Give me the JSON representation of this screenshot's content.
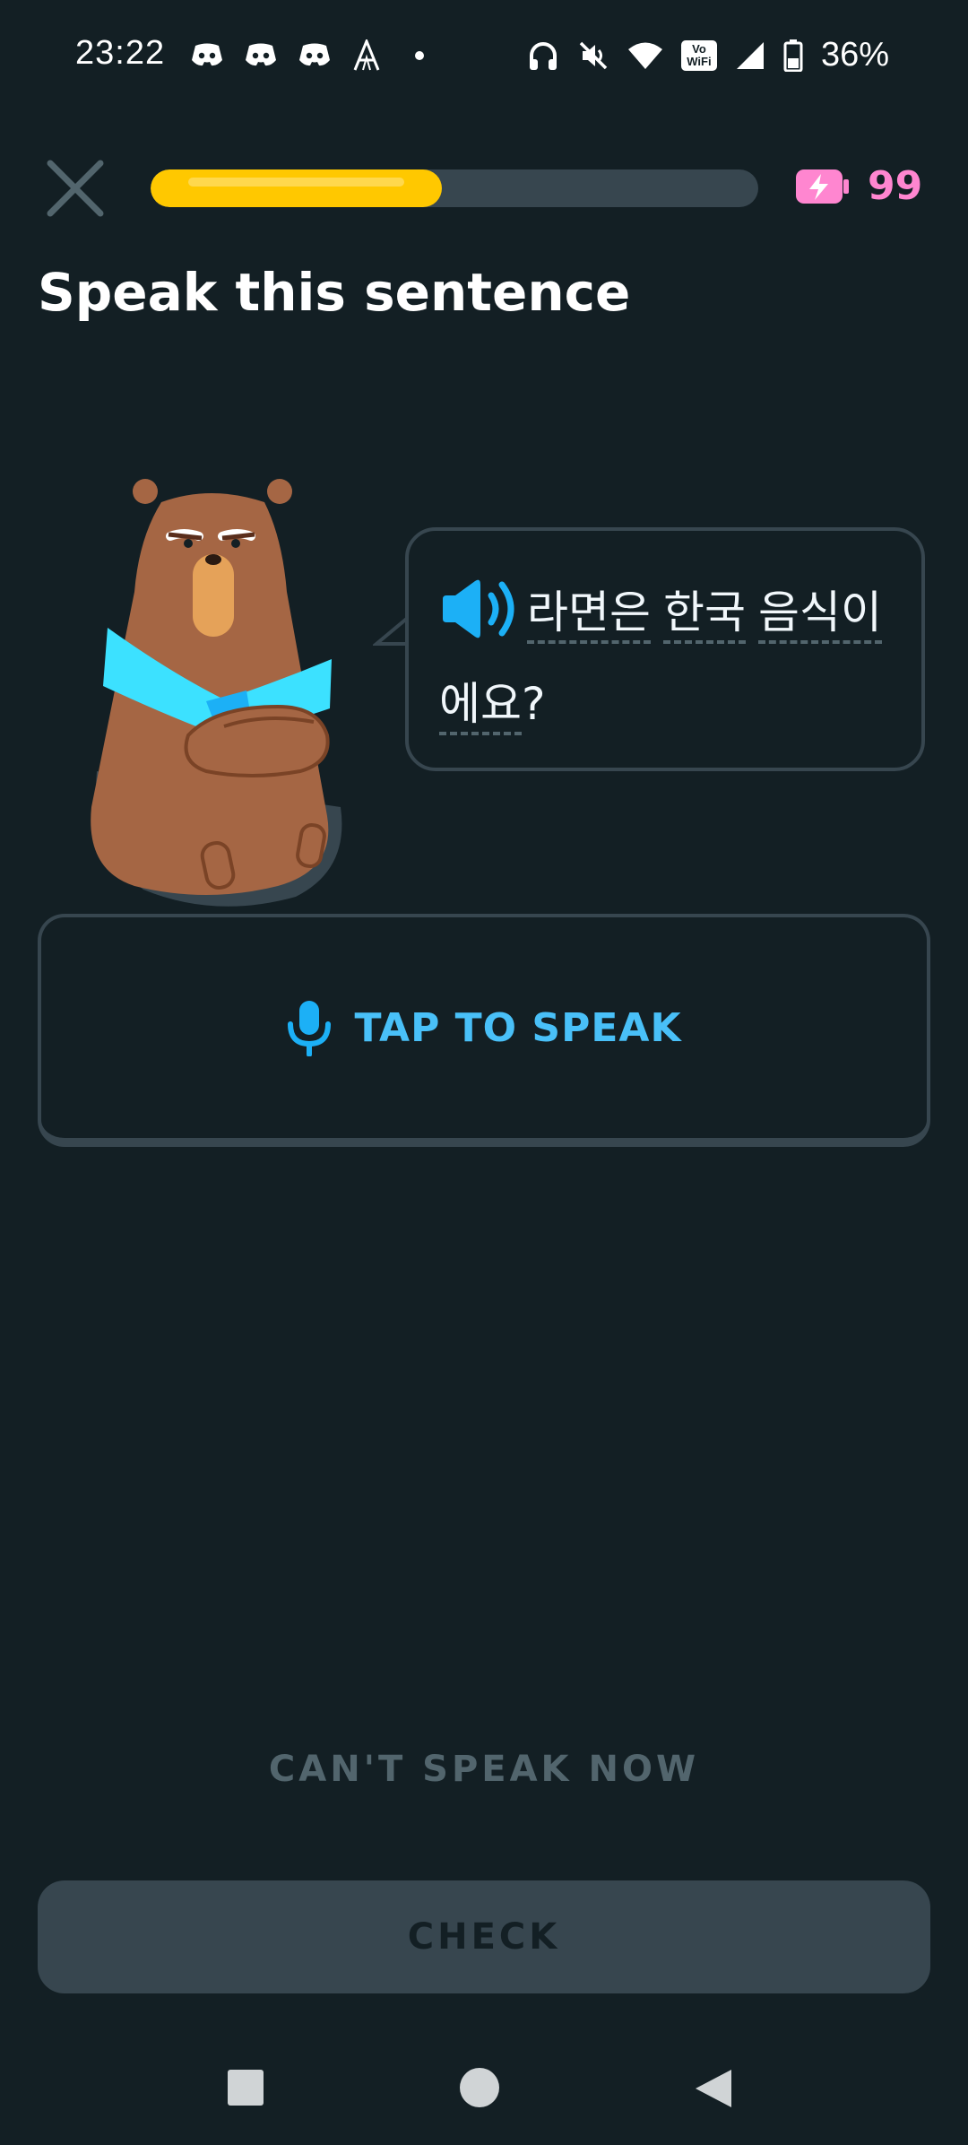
{
  "status_bar": {
    "time": "23:22",
    "battery_percent": "36%",
    "left_icons": [
      "discord-icon",
      "discord-icon",
      "discord-icon",
      "font-icon",
      "dot-icon"
    ],
    "right_icons": [
      "headphones-icon",
      "mute-icon",
      "wifi-icon",
      "vowifi-icon",
      "signal-icon",
      "battery-icon"
    ],
    "vowifi_line1": "Vo",
    "vowifi_line2": "WiFi"
  },
  "header": {
    "progress_fraction": 0.48,
    "energy_count": "99",
    "colors": {
      "progress": "#ffc800",
      "track": "#37464f",
      "energy": "#ff86d0"
    }
  },
  "challenge": {
    "title": "Speak this sentence",
    "words": [
      "라면은",
      "한국",
      "음식이",
      "에요"
    ],
    "punctuation": "?",
    "speak_button_label": "TAP TO SPEAK",
    "speak_button_color": "#49c0f8"
  },
  "footer": {
    "cant_speak_label": "CAN'T SPEAK NOW",
    "check_label": "CHECK"
  },
  "nav": {
    "buttons": [
      "recents-button",
      "home-button",
      "back-button"
    ]
  }
}
